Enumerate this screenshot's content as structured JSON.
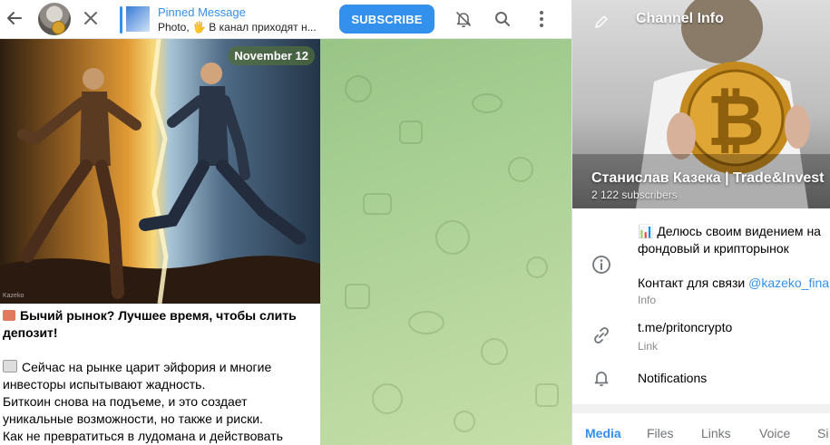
{
  "header": {
    "back_icon": "arrow-left-icon",
    "close_icon": "close-icon",
    "pinned": {
      "title": "Pinned Message",
      "text": "Photo, 🖐 В канал приходят н..."
    },
    "subscribe_label": "SUBSCRIBE",
    "mute_icon": "bell-off-icon",
    "search_icon": "search-icon",
    "menu_icon": "more-vertical-icon"
  },
  "message": {
    "date": "November 12",
    "heading": "Бычий рынок? Лучшее время, чтобы слить депозит!",
    "lines": [
      "Сейчас на рынке царит эйфория и многие инвесторы испытывают жадность.",
      "Биткоин снова на подъеме, и это создает уникальные возможности, но также и риски.",
      "Как не превратиться в лудомана и действовать"
    ],
    "watermark": "Kazeko"
  },
  "channel": {
    "title": "Channel Info",
    "name": "Станислав Казека | Trade&Invest",
    "subscribers": "2 122 subscribers",
    "description_line1": "📊 Делюсь своим видением на",
    "description_line2": "фондовый и крипторынок",
    "contact_prefix": "Контакт для связи ",
    "contact_link": "@kazeko_fina",
    "info_label": "Info",
    "link_value": "t.me/pritoncrypto",
    "link_label": "Link",
    "notifications_label": "Notifications",
    "tabs": [
      "Media",
      "Files",
      "Links",
      "Voice",
      "Si"
    ]
  },
  "colors": {
    "accent": "#3390ec",
    "chat_bg": "#a7cf93",
    "date_chip": "#506e3c"
  }
}
